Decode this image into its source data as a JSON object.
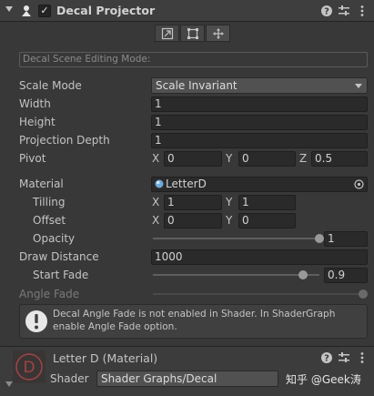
{
  "component": {
    "title": "Decal Projector",
    "enabled": true
  },
  "edit_toolbar": {
    "buttons": [
      "edit-bounds-icon",
      "scale-handles-icon",
      "move-pivot-icon"
    ]
  },
  "scene_editing_mode": {
    "placeholder": "Decal Scene Editing Mode:"
  },
  "properties": {
    "scale_mode": {
      "label": "Scale Mode",
      "value": "Scale Invariant"
    },
    "width": {
      "label": "Width",
      "value": "1"
    },
    "height": {
      "label": "Height",
      "value": "1"
    },
    "projection_depth": {
      "label": "Projection Depth",
      "value": "1"
    },
    "pivot": {
      "label": "Pivot",
      "x_label": "X",
      "x": "0",
      "y_label": "Y",
      "y": "0",
      "z_label": "Z",
      "z": "0.5"
    },
    "material": {
      "label": "Material",
      "value": "LetterD"
    },
    "tiling": {
      "label": "Tilling",
      "x_label": "X",
      "x": "1",
      "y_label": "Y",
      "y": "1"
    },
    "offset": {
      "label": "Offset",
      "x_label": "X",
      "x": "0",
      "y_label": "Y",
      "y": "0"
    },
    "opacity": {
      "label": "Opacity",
      "value": "1",
      "level": 1.0
    },
    "draw_distance": {
      "label": "Draw Distance",
      "value": "1000"
    },
    "start_fade": {
      "label": "Start Fade",
      "value": "0.9",
      "level": 0.9
    },
    "angle_fade": {
      "label": "Angle Fade"
    }
  },
  "warning": {
    "text": "Decal Angle Fade is not enabled in Shader. In ShaderGraph enable Angle Fade option."
  },
  "material_section": {
    "title": "Letter D (Material)",
    "shader_label": "Shader",
    "shader_value": "Shader Graphs/Decal",
    "watermark": "知乎 @Geek涛"
  }
}
